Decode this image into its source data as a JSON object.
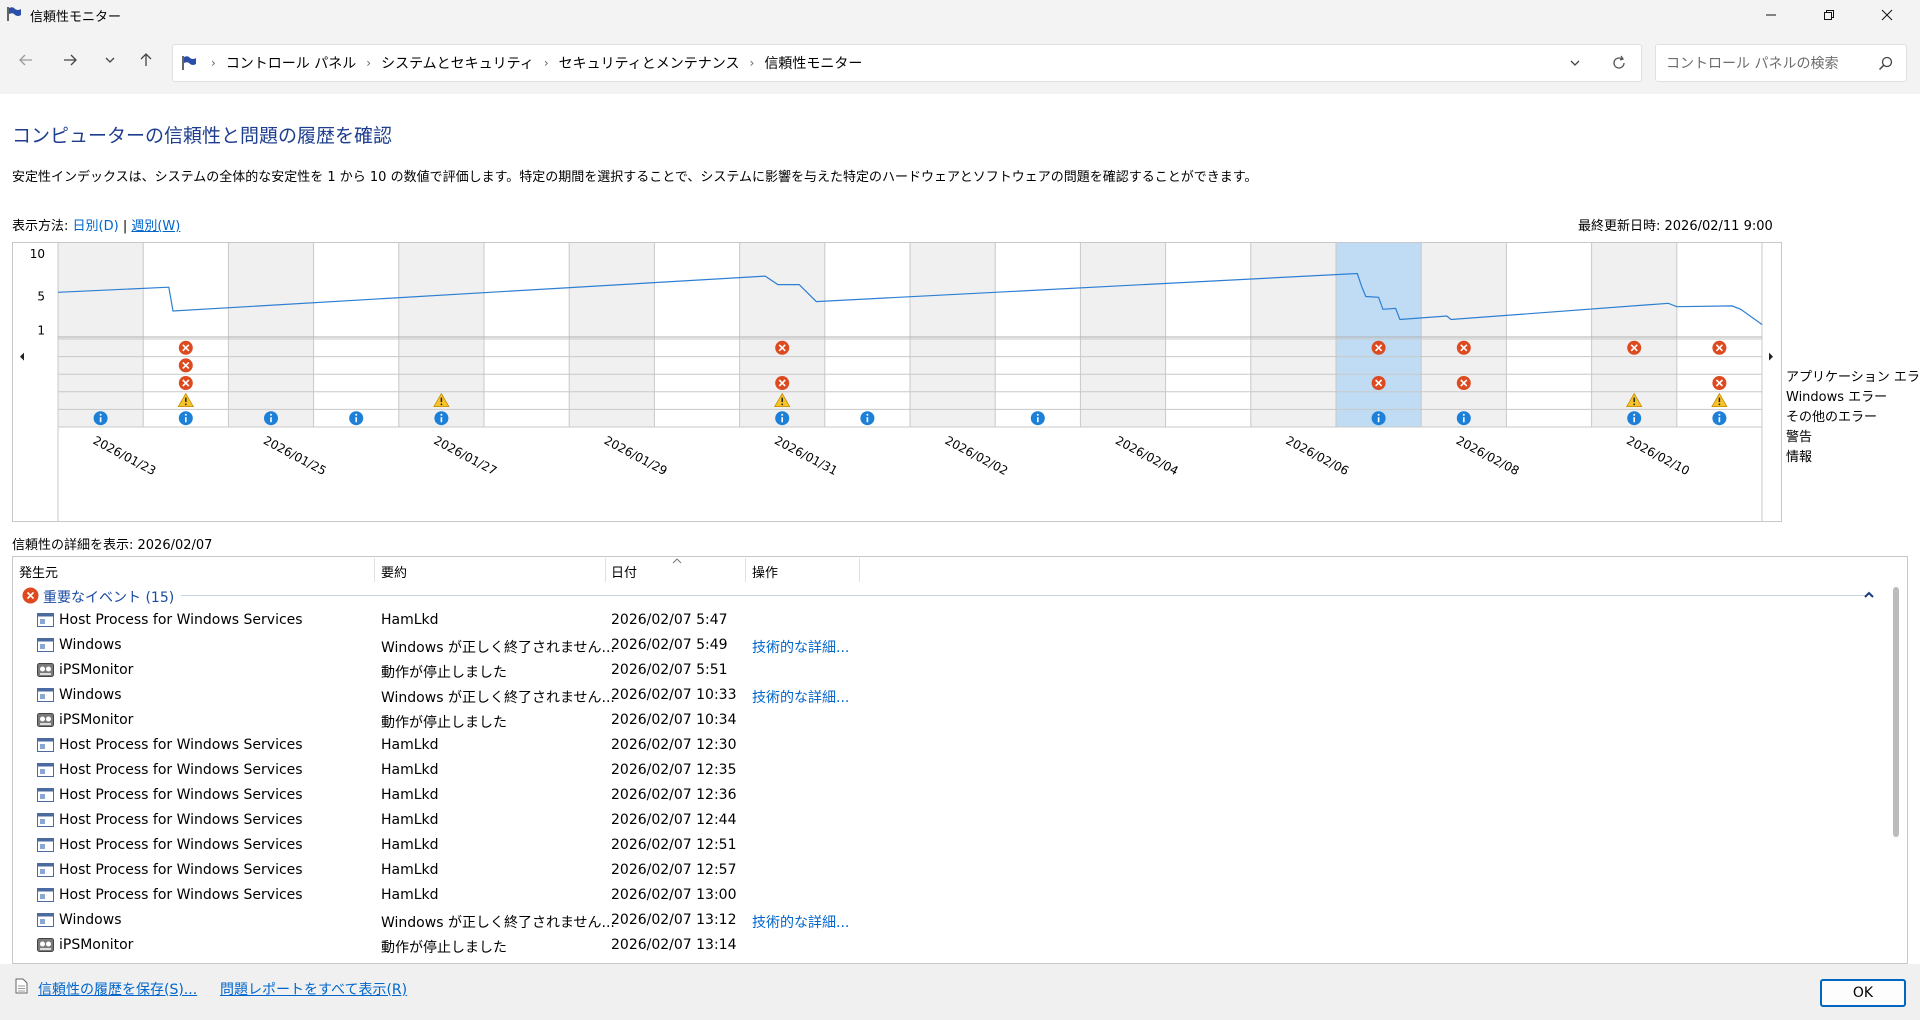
{
  "window": {
    "title": "信頼性モニター"
  },
  "nav": {
    "breadcrumb": [
      "コントロール パネル",
      "システムとセキュリティ",
      "セキュリティとメンテナンス",
      "信頼性モニター"
    ],
    "search_placeholder": "コントロール パネルの検索"
  },
  "page": {
    "heading": "コンピューターの信頼性と問題の履歴を確認",
    "description": "安定性インデックスは、システムの全体的な安定性を 1 から 10 の数値で評価します。特定の期間を選択することで、システムに影響を与えた特定のハードウェアとソフトウェアの問題を確認することができます。",
    "view_by_label": "表示方法:",
    "view_daily": "日別(D)",
    "view_separator": "|",
    "view_weekly": "週別(W)",
    "last_updated": "最終更新日時: 2026/02/11 9:00"
  },
  "chart_data": {
    "type": "line",
    "y_ticks": [
      "10",
      "5",
      "1"
    ],
    "ylim": [
      1,
      10
    ],
    "day_count": 20,
    "x_tick_labels": [
      "2026/01/23",
      "2026/01/25",
      "2026/01/27",
      "2026/01/29",
      "2026/01/31",
      "2026/02/02",
      "2026/02/04",
      "2026/02/06",
      "2026/02/08",
      "2026/02/10"
    ],
    "selected_day_index": 15,
    "stability_index": [
      [
        0,
        5.5
      ],
      [
        1.3,
        6.1
      ],
      [
        1.35,
        3.3
      ],
      [
        8.3,
        7.4
      ],
      [
        8.45,
        6.4
      ],
      [
        8.7,
        6.4
      ],
      [
        8.9,
        4.4
      ],
      [
        15.25,
        7.7
      ],
      [
        15.3,
        6.2
      ],
      [
        15.35,
        5.0
      ],
      [
        15.5,
        4.9
      ],
      [
        15.55,
        3.5
      ],
      [
        15.7,
        3.6
      ],
      [
        15.75,
        2.3
      ],
      [
        16.3,
        2.7
      ],
      [
        16.35,
        2.3
      ],
      [
        18.9,
        4.2
      ],
      [
        19.0,
        3.8
      ],
      [
        19.65,
        3.9
      ],
      [
        19.75,
        3.5
      ],
      [
        20,
        1.7
      ]
    ],
    "event_rows": [
      "アプリケーション エラー",
      "Windows エラー",
      "その他のエラー",
      "警告",
      "情報"
    ],
    "events": [
      {
        "row": 0,
        "days": [
          1,
          8,
          15,
          16,
          18,
          19
        ]
      },
      {
        "row": 1,
        "days": [
          1
        ]
      },
      {
        "row": 2,
        "days": [
          1,
          8,
          15,
          16,
          19
        ]
      },
      {
        "row": 3,
        "days": [
          1,
          4,
          8,
          18,
          19
        ]
      },
      {
        "row": 4,
        "days": [
          0,
          1,
          2,
          3,
          4,
          8,
          9,
          11,
          15,
          16,
          18,
          19
        ]
      }
    ],
    "colors": {
      "line": "#2d7fd3",
      "selected": "#bfdcf4",
      "shaded": "#f0f0f0",
      "error": "#de4a1f",
      "warning": "#f7c32b",
      "info": "#1c7fd8"
    }
  },
  "details": {
    "header": "信頼性の詳細を表示: 2026/02/07",
    "columns": [
      "発生元",
      "要約",
      "日付",
      "操作"
    ],
    "group_label": "重要なイベント (15)",
    "rows": [
      {
        "source": "Host Process for Windows Services",
        "summary": "HamLkd",
        "date": "2026/02/07 5:47",
        "action": "",
        "icon": "app-icon"
      },
      {
        "source": "Windows",
        "summary": "Windows が正しく終了されません...",
        "date": "2026/02/07 5:49",
        "action": "技術的な詳細...",
        "icon": "app-icon"
      },
      {
        "source": "iPSMonitor",
        "summary": "動作が停止しました",
        "date": "2026/02/07 5:51",
        "action": "",
        "icon": "monitor-icon"
      },
      {
        "source": "Windows",
        "summary": "Windows が正しく終了されません...",
        "date": "2026/02/07 10:33",
        "action": "技術的な詳細...",
        "icon": "app-icon"
      },
      {
        "source": "iPSMonitor",
        "summary": "動作が停止しました",
        "date": "2026/02/07 10:34",
        "action": "",
        "icon": "monitor-icon"
      },
      {
        "source": "Host Process for Windows Services",
        "summary": "HamLkd",
        "date": "2026/02/07 12:30",
        "action": "",
        "icon": "app-icon"
      },
      {
        "source": "Host Process for Windows Services",
        "summary": "HamLkd",
        "date": "2026/02/07 12:35",
        "action": "",
        "icon": "app-icon"
      },
      {
        "source": "Host Process for Windows Services",
        "summary": "HamLkd",
        "date": "2026/02/07 12:36",
        "action": "",
        "icon": "app-icon"
      },
      {
        "source": "Host Process for Windows Services",
        "summary": "HamLkd",
        "date": "2026/02/07 12:44",
        "action": "",
        "icon": "app-icon"
      },
      {
        "source": "Host Process for Windows Services",
        "summary": "HamLkd",
        "date": "2026/02/07 12:51",
        "action": "",
        "icon": "app-icon"
      },
      {
        "source": "Host Process for Windows Services",
        "summary": "HamLkd",
        "date": "2026/02/07 12:57",
        "action": "",
        "icon": "app-icon"
      },
      {
        "source": "Host Process for Windows Services",
        "summary": "HamLkd",
        "date": "2026/02/07 13:00",
        "action": "",
        "icon": "app-icon"
      },
      {
        "source": "Windows",
        "summary": "Windows が正しく終了されません...",
        "date": "2026/02/07 13:12",
        "action": "技術的な詳細...",
        "icon": "app-icon"
      },
      {
        "source": "iPSMonitor",
        "summary": "動作が停止しました",
        "date": "2026/02/07 13:14",
        "action": "",
        "icon": "monitor-icon"
      }
    ]
  },
  "footer": {
    "save_history": "信頼性の履歴を保存(S)...",
    "view_all_reports": "問題レポートをすべて表示(R)",
    "ok_label": "OK"
  }
}
